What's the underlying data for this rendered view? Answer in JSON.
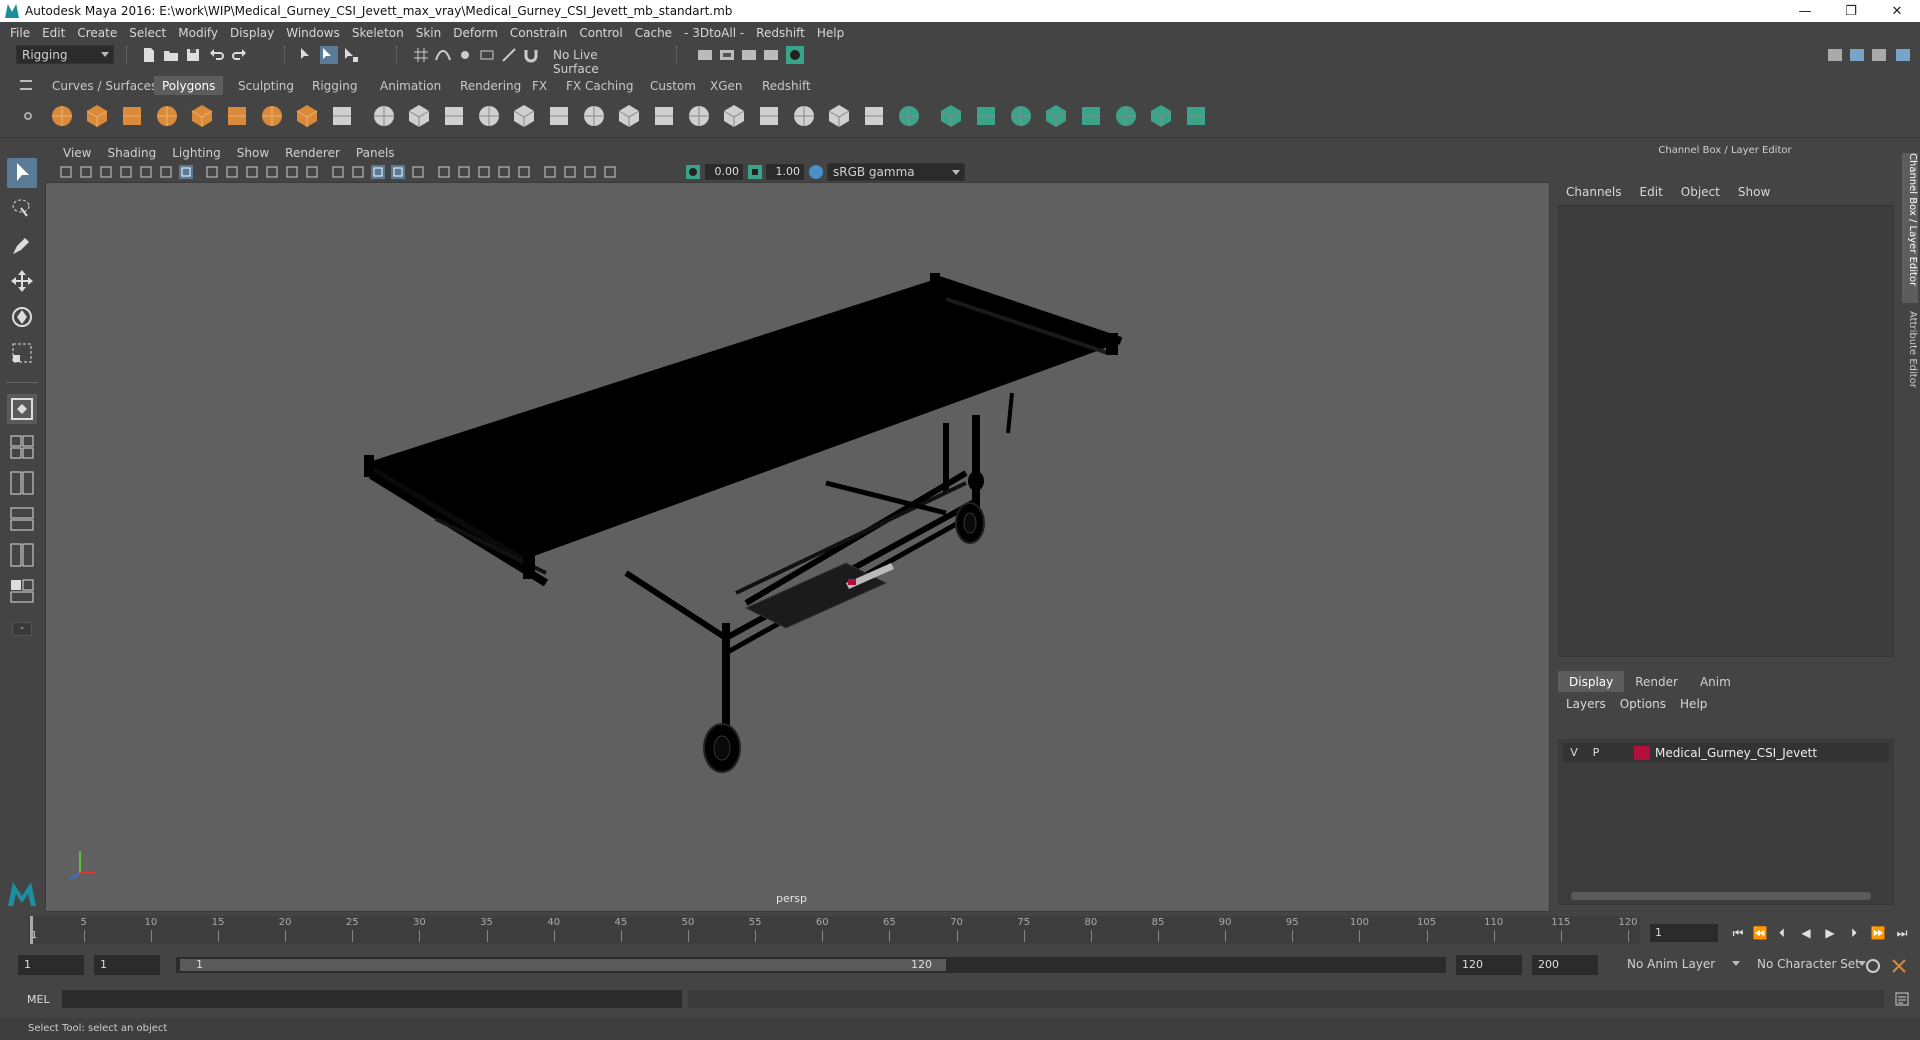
{
  "window": {
    "title": "Autodesk Maya 2016: E:\\work\\WIP\\Medical_Gurney_CSI_Jevett_max_vray\\Medical_Gurney_CSI_Jevett_mb_standart.mb",
    "minimize": "—",
    "restore": "❐",
    "close": "✕"
  },
  "menubar": [
    "File",
    "Edit",
    "Create",
    "Select",
    "Modify",
    "Display",
    "Windows",
    "Skeleton",
    "Skin",
    "Deform",
    "Constrain",
    "Control",
    "Cache",
    "- 3DtoAll -",
    "Redshift",
    "Help"
  ],
  "statusline": {
    "mode": "Rigging",
    "live_surface": "No Live Surface"
  },
  "shelf": {
    "tabs": [
      "Curves / Surfaces",
      "Polygons",
      "Sculpting",
      "Rigging",
      "Animation",
      "Rendering",
      "FX",
      "FX Caching",
      "Custom",
      "XGen",
      "Redshift"
    ],
    "active_tab": "Polygons"
  },
  "viewport": {
    "menu": [
      "View",
      "Shading",
      "Lighting",
      "Show",
      "Renderer",
      "Panels"
    ],
    "exposure": "0.00",
    "gamma": "1.00",
    "color_space": "sRGB gamma",
    "camera": "persp"
  },
  "right_panel": {
    "title": "Channel Box / Layer Editor",
    "channel_menu": [
      "Channels",
      "Edit",
      "Object",
      "Show"
    ],
    "layer_tabs": [
      "Display",
      "Render",
      "Anim"
    ],
    "active_layer_tab": "Display",
    "layer_menu": [
      "Layers",
      "Options",
      "Help"
    ],
    "layers": [
      {
        "v": "V",
        "p": "P",
        "name": "Medical_Gurney_CSI_Jevett",
        "color": "#b0103a"
      }
    ],
    "side_tabs": [
      "Channel Box / Layer Editor",
      "Attribute Editor"
    ]
  },
  "timeline": {
    "ticks": [
      "1",
      "5",
      "10",
      "15",
      "20",
      "25",
      "30",
      "35",
      "40",
      "45",
      "50",
      "55",
      "60",
      "65",
      "70",
      "75",
      "80",
      "85",
      "90",
      "95",
      "100",
      "105",
      "110",
      "115",
      "120"
    ],
    "current_frame": "1"
  },
  "range": {
    "start": "1",
    "playback_start": "1",
    "range_start_label": "1",
    "range_end_label": "120",
    "playback_end": "120",
    "end": "200",
    "anim_layer": "No Anim Layer",
    "character_set": "No Character Set"
  },
  "command_line": {
    "label": "MEL"
  },
  "help_line": "Select Tool: select an object"
}
